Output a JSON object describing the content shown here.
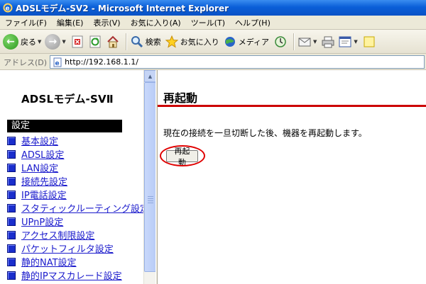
{
  "window": {
    "title": "ADSLモデム-SV2 - Microsoft Internet Explorer"
  },
  "menu": [
    "ファイル(F)",
    "編集(E)",
    "表示(V)",
    "お気に入り(A)",
    "ツール(T)",
    "ヘルプ(H)"
  ],
  "toolbar": {
    "back_label": "戻る",
    "search_label": "検索",
    "favorites_label": "お気に入り",
    "media_label": "メディア"
  },
  "address": {
    "label": "アドレス(D)",
    "url": "http://192.168.1.1/"
  },
  "sidebar": {
    "logo": "ADSLモデム-SVⅡ",
    "section": "設定",
    "items": [
      "基本設定",
      "ADSL設定",
      "LAN設定",
      "接続先設定",
      "IP電話設定",
      "スタティックルーティング設定",
      "UPnP設定",
      "アクセス制限設定",
      "パケットフィルタ設定",
      "静的NAT設定",
      "静的IPマスカレード設定"
    ]
  },
  "main": {
    "title": "再起動",
    "description": "現在の接続を一旦切断した後、機器を再起動します。",
    "button_label": "再起動"
  },
  "colors": {
    "titlebar": "#0a5fd8",
    "title_rule": "#cc0000",
    "highlight": "#e00000",
    "link": "#1a1acc"
  }
}
